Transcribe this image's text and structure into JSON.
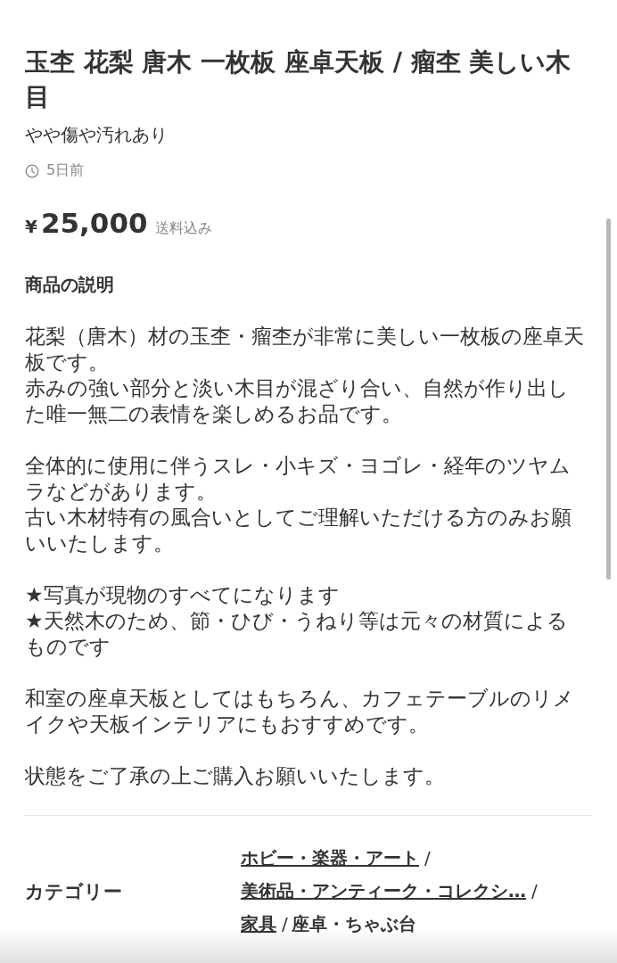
{
  "title": "玉杢 花梨 唐木 一枚板 座卓天板 / 瘤杢 美しい木目",
  "condition": "やや傷や汚れあり",
  "posted": "5日前",
  "price": {
    "currency": "¥",
    "amount": "25,000",
    "note": "送料込み"
  },
  "description": {
    "heading": "商品の説明",
    "paragraphs": [
      [
        "花梨（唐木）材の玉杢・瘤杢が非常に美しい一枚板の座卓天板です。",
        "赤みの強い部分と淡い木目が混ざり合い、自然が作り出した唯一無二の表情を楽しめるお品です。"
      ],
      [
        "全体的に使用に伴うスレ・小キズ・ヨゴレ・経年のツヤムラなどがあります。",
        "古い木材特有の風合いとしてご理解いただける方のみお願いいたします。"
      ],
      [
        "★写真が現物のすべてになります",
        "★天然木のため、節・ひび・うねり等は元々の材質によるものです"
      ],
      [
        "和室の座卓天板としてはもちろん、カフェテーブルのリメイクや天板インテリアにもおすすめです。"
      ],
      [
        "状態をご了承の上ご購入お願いいたします。"
      ]
    ]
  },
  "category": {
    "label": "カテゴリー",
    "lines": [
      [
        {
          "kind": "link",
          "text": "ホビー・楽器・アート"
        },
        {
          "kind": "separator",
          "text": "/"
        }
      ],
      [
        {
          "kind": "link",
          "text": "美術品・アンティーク・コレクシ…"
        },
        {
          "kind": "separator",
          "text": "/"
        }
      ],
      [
        {
          "kind": "link",
          "text": "家具"
        },
        {
          "kind": "separator",
          "text": "/"
        },
        {
          "kind": "plain",
          "text": "座卓・ちゃぶ台"
        }
      ]
    ]
  }
}
